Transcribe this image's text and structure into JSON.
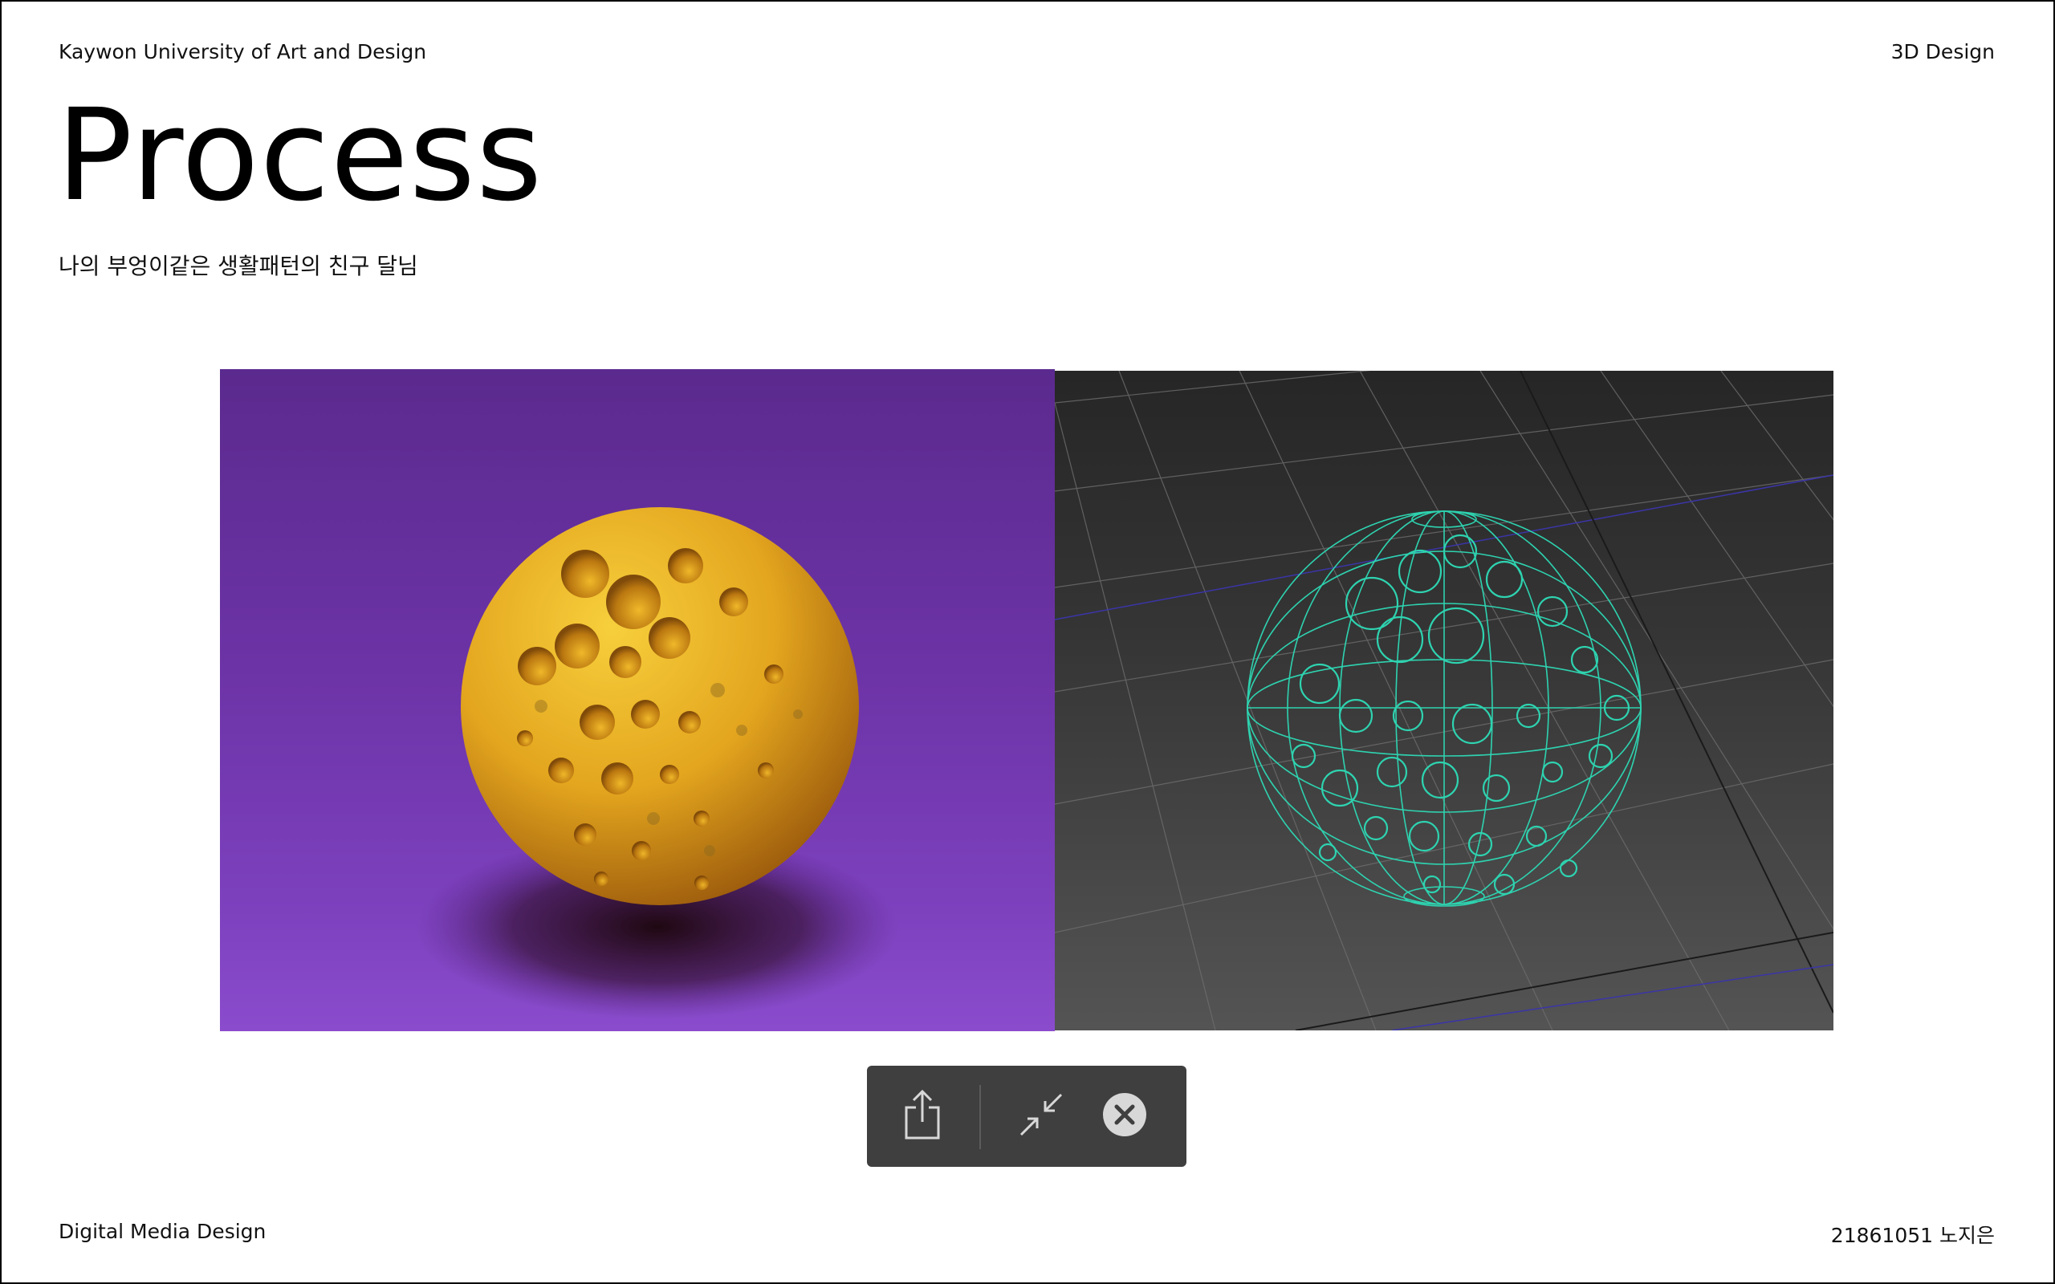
{
  "header": {
    "university": "Kaywon University of Art and Design",
    "course": "3D Design"
  },
  "main": {
    "title": "Process",
    "subtitle": "나의 부엉이같은 생활패턴의 친구 달님"
  },
  "figure": {
    "left_image": "rendered-moon-sphere",
    "right_image": "wireframe-moon-sphere",
    "colors": {
      "render_background": "#6c33a6",
      "moon": "#e3a51e",
      "wire": "#2ed3b0",
      "viewport_background": "#3a3a3a"
    }
  },
  "toolbar": {
    "icons": [
      "share-icon",
      "shrink-icon",
      "close-icon"
    ]
  },
  "footer": {
    "department": "Digital Media Design",
    "student": "21861051 노지은"
  }
}
